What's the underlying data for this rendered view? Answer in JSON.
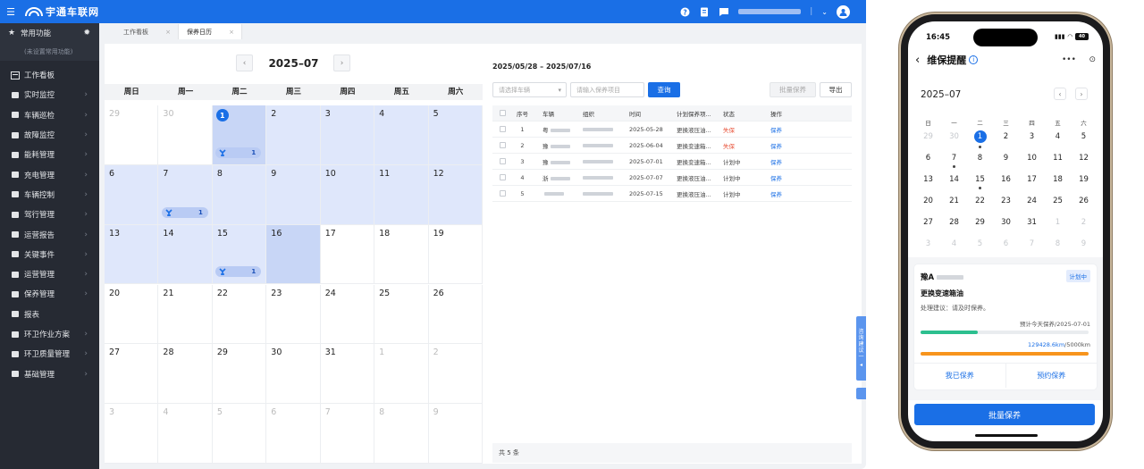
{
  "app": {
    "brand": "宇通车联网",
    "colors": {
      "primary": "#1a6fe6",
      "sidebar": "#262a33",
      "danger": "#e8553c",
      "highlight": "#dfe7fb"
    }
  },
  "sidebar": {
    "common_label": "常用功能",
    "common_hint": "(未设置常用功能)",
    "items": [
      {
        "label": "工作看板",
        "icon": "dashboard-icon",
        "has_children": false
      },
      {
        "label": "实时监控",
        "icon": "truck-icon",
        "has_children": true
      },
      {
        "label": "车辆巡检",
        "icon": "monitor-icon",
        "has_children": true
      },
      {
        "label": "故障监控",
        "icon": "alarm-icon",
        "has_children": true
      },
      {
        "label": "能耗管理",
        "icon": "fuel-icon",
        "has_children": true
      },
      {
        "label": "充电管理",
        "icon": "battery-icon",
        "has_children": true
      },
      {
        "label": "车辆控制",
        "icon": "control-icon",
        "has_children": true
      },
      {
        "label": "驾行管理",
        "icon": "steering-icon",
        "has_children": true
      },
      {
        "label": "运营报告",
        "icon": "report-icon",
        "has_children": true
      },
      {
        "label": "关键事件",
        "icon": "event-icon",
        "has_children": true
      },
      {
        "label": "运营管理",
        "icon": "manage-icon",
        "has_children": true
      },
      {
        "label": "保养管理",
        "icon": "maintain-icon",
        "has_children": true
      },
      {
        "label": "报表",
        "icon": "list-icon",
        "has_children": false
      },
      {
        "label": "环卫作业方案",
        "icon": "plan-icon",
        "has_children": true
      },
      {
        "label": "环卫质量管理",
        "icon": "quality-icon",
        "has_children": true
      },
      {
        "label": "基础管理",
        "icon": "base-icon",
        "has_children": true
      }
    ]
  },
  "tabs": [
    {
      "label": "工作看板",
      "active": false
    },
    {
      "label": "保养日历",
      "active": true
    }
  ],
  "calendar": {
    "month_title": "2025–07",
    "weekdays": [
      "周日",
      "周一",
      "周二",
      "周三",
      "周四",
      "周五",
      "周六"
    ],
    "days": [
      {
        "d": "29",
        "cur": false,
        "hl": false
      },
      {
        "d": "30",
        "cur": false,
        "hl": false
      },
      {
        "d": "1",
        "cur": true,
        "hl": true,
        "today": true,
        "sel": true,
        "badge": "1"
      },
      {
        "d": "2",
        "cur": true,
        "hl": true
      },
      {
        "d": "3",
        "cur": true,
        "hl": true
      },
      {
        "d": "4",
        "cur": true,
        "hl": true
      },
      {
        "d": "5",
        "cur": true,
        "hl": true
      },
      {
        "d": "6",
        "cur": true,
        "hl": true
      },
      {
        "d": "7",
        "cur": true,
        "hl": true,
        "badge": "1",
        "round": true
      },
      {
        "d": "8",
        "cur": true,
        "hl": true
      },
      {
        "d": "9",
        "cur": true,
        "hl": true
      },
      {
        "d": "10",
        "cur": true,
        "hl": true
      },
      {
        "d": "11",
        "cur": true,
        "hl": true
      },
      {
        "d": "12",
        "cur": true,
        "hl": true
      },
      {
        "d": "13",
        "cur": true,
        "hl": true
      },
      {
        "d": "14",
        "cur": true,
        "hl": true
      },
      {
        "d": "15",
        "cur": true,
        "hl": true,
        "badge": "1"
      },
      {
        "d": "16",
        "cur": true,
        "hl": true,
        "sel": true
      },
      {
        "d": "17",
        "cur": true,
        "hl": false
      },
      {
        "d": "18",
        "cur": true,
        "hl": false
      },
      {
        "d": "19",
        "cur": true,
        "hl": false
      },
      {
        "d": "20",
        "cur": true,
        "hl": false
      },
      {
        "d": "21",
        "cur": true,
        "hl": false
      },
      {
        "d": "22",
        "cur": true,
        "hl": false
      },
      {
        "d": "23",
        "cur": true,
        "hl": false
      },
      {
        "d": "24",
        "cur": true,
        "hl": false
      },
      {
        "d": "25",
        "cur": true,
        "hl": false
      },
      {
        "d": "26",
        "cur": true,
        "hl": false
      },
      {
        "d": "27",
        "cur": true,
        "hl": false
      },
      {
        "d": "28",
        "cur": true,
        "hl": false
      },
      {
        "d": "29",
        "cur": true,
        "hl": false
      },
      {
        "d": "30",
        "cur": true,
        "hl": false
      },
      {
        "d": "31",
        "cur": true,
        "hl": false
      },
      {
        "d": "1",
        "cur": false,
        "hl": false
      },
      {
        "d": "2",
        "cur": false,
        "hl": false
      },
      {
        "d": "3",
        "cur": false,
        "hl": false
      },
      {
        "d": "4",
        "cur": false,
        "hl": false
      },
      {
        "d": "5",
        "cur": false,
        "hl": false
      },
      {
        "d": "6",
        "cur": false,
        "hl": false
      },
      {
        "d": "7",
        "cur": false,
        "hl": false
      },
      {
        "d": "8",
        "cur": false,
        "hl": false
      },
      {
        "d": "9",
        "cur": false,
        "hl": false
      }
    ]
  },
  "panel": {
    "range": "2025/05/28 – 2025/07/16",
    "vehicle_placeholder": "请选择车辆",
    "item_placeholder": "请输入保养项目",
    "query_label": "查询",
    "batch_label": "批量保养",
    "export_label": "导出",
    "columns": [
      "序号",
      "车辆",
      "组织",
      "时间",
      "计划保养项...",
      "状态",
      "操作"
    ],
    "rows": [
      {
        "no": "1",
        "plate": "粤",
        "date": "2025-05-28",
        "item": "更换液压油...",
        "status": "失保",
        "overdue": true,
        "action": "保养"
      },
      {
        "no": "2",
        "plate": "豫",
        "date": "2025-06-04",
        "item": "更换变速箱...",
        "status": "失保",
        "overdue": true,
        "action": "保养"
      },
      {
        "no": "3",
        "plate": "豫",
        "date": "2025-07-01",
        "item": "更换变速箱...",
        "status": "计划中",
        "overdue": false,
        "action": "保养"
      },
      {
        "no": "4",
        "plate": "浙",
        "date": "2025-07-07",
        "item": "更换液压油...",
        "status": "计划中",
        "overdue": false,
        "action": "保养"
      },
      {
        "no": "5",
        "plate": "",
        "date": "2025-07-15",
        "item": "更换液压油...",
        "status": "计划中",
        "overdue": false,
        "action": "保养"
      }
    ],
    "total": "共 5 条"
  },
  "float_tab": "咨询建议一",
  "mobile": {
    "time": "16:45",
    "battery": "40",
    "title": "维保提醒",
    "month": "2025–07",
    "weekdays": [
      "日",
      "一",
      "二",
      "三",
      "四",
      "五",
      "六"
    ],
    "days": [
      {
        "d": "29",
        "o": true
      },
      {
        "d": "30",
        "o": true
      },
      {
        "d": "1",
        "today": true,
        "dot": true
      },
      {
        "d": "2"
      },
      {
        "d": "3"
      },
      {
        "d": "4"
      },
      {
        "d": "5"
      },
      {
        "d": "6"
      },
      {
        "d": "7",
        "dot": true
      },
      {
        "d": "8"
      },
      {
        "d": "9"
      },
      {
        "d": "10"
      },
      {
        "d": "11"
      },
      {
        "d": "12"
      },
      {
        "d": "13"
      },
      {
        "d": "14"
      },
      {
        "d": "15",
        "dot": true
      },
      {
        "d": "16"
      },
      {
        "d": "17"
      },
      {
        "d": "18"
      },
      {
        "d": "19"
      },
      {
        "d": "20"
      },
      {
        "d": "21"
      },
      {
        "d": "22"
      },
      {
        "d": "23"
      },
      {
        "d": "24"
      },
      {
        "d": "25"
      },
      {
        "d": "26"
      },
      {
        "d": "27"
      },
      {
        "d": "28"
      },
      {
        "d": "29"
      },
      {
        "d": "30"
      },
      {
        "d": "31"
      },
      {
        "d": "1",
        "o": true
      },
      {
        "d": "2",
        "o": true
      },
      {
        "d": "3",
        "o": true
      },
      {
        "d": "4",
        "o": true
      },
      {
        "d": "5",
        "o": true
      },
      {
        "d": "6",
        "o": true
      },
      {
        "d": "7",
        "o": true
      },
      {
        "d": "8",
        "o": true
      },
      {
        "d": "9",
        "o": true
      }
    ],
    "card": {
      "plate": "豫A",
      "status": "计划中",
      "item": "更换变速箱油",
      "advice": "处理建议：请及时保养。",
      "estimate": "预计今天保养/2025-07-01",
      "time_progress": 0.34,
      "mileage_value": "129428.6km",
      "mileage_total": "/5000km",
      "mileage_progress": 1.0,
      "done_label": "我已保养",
      "book_label": "预约保养"
    },
    "batch_label": "批量保养"
  }
}
